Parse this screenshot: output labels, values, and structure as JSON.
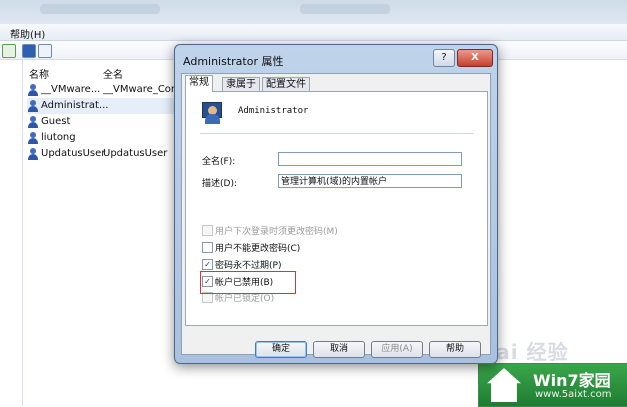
{
  "menubar": {
    "help": "帮助(H)"
  },
  "list": {
    "columns": [
      "名称",
      "全名"
    ],
    "rows": [
      {
        "name": "__VMware...",
        "fullname": "__VMware_Conv",
        "selected": false
      },
      {
        "name": "Administrat...",
        "fullname": "",
        "selected": true
      },
      {
        "name": "Guest",
        "fullname": "",
        "selected": false
      },
      {
        "name": "liutong",
        "fullname": "",
        "selected": false
      },
      {
        "name": "UpdatusUser",
        "fullname": "UpdatusUser",
        "selected": false
      }
    ]
  },
  "dialog": {
    "title": "Administrator 属性",
    "help_glyph": "?",
    "close_glyph": "X",
    "tabs": [
      "常规",
      "隶属于",
      "配置文件"
    ],
    "active_tab": "常规",
    "username": "Administrator",
    "fullname_label": "全名(F):",
    "fullname_value": "",
    "description_label": "描述(D):",
    "description_value": "管理计算机(域)的内置帐户",
    "checkboxes": [
      {
        "label": "用户下次登录时须更改密码(M)",
        "checked": false,
        "disabled": true
      },
      {
        "label": "用户不能更改密码(C)",
        "checked": false,
        "disabled": false
      },
      {
        "label": "密码永不过期(P)",
        "checked": true,
        "disabled": false
      },
      {
        "label": "帐户已禁用(B)",
        "checked": true,
        "disabled": false
      },
      {
        "label": "帐户已锁定(O)",
        "checked": false,
        "disabled": true
      }
    ],
    "check_glyph": "✓",
    "buttons": {
      "ok": "确定",
      "cancel": "取消",
      "apply": "应用(A)",
      "help": "帮助"
    }
  },
  "watermark": {
    "text": "Bai 经验"
  },
  "logo": {
    "title": "Win7家园",
    "url": "www.5aixt.com"
  },
  "colors": {
    "highlight": "#d9343c",
    "selection": "#e5eef9",
    "logo_green": "#2a8f3d"
  }
}
